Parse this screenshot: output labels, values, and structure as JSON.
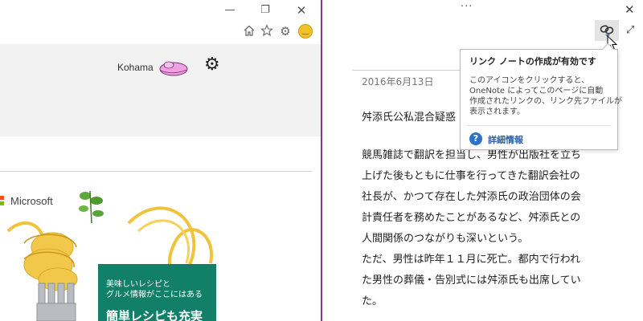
{
  "browser": {
    "window_buttons": {
      "minimize": "—",
      "restore": "❐",
      "close": "✕"
    },
    "toolbar_icons": [
      "home-icon",
      "star-icon",
      "gear-icon",
      "smiley-icon"
    ],
    "header": {
      "username": "Kohama"
    },
    "ad": {
      "brand": "Microsoft",
      "line1": "美味しいレシピと",
      "line2": "グルメ情報がここにはある",
      "line3": "簡単レシピも充実",
      "card_color": "#128068"
    }
  },
  "onenote": {
    "accent_color": "#7a3b8f",
    "menu_dots": "···",
    "close": "✕",
    "expand": "⤢",
    "note": {
      "date": "2016年6月13日",
      "title": "舛添氏公私混合疑惑",
      "body_lines": [
        "競馬雑誌で翻訳を担当し、男性が出版社を立ち",
        "上げた後もともに仕事を行ってきた翻訳会社の",
        "社長が、かつて存在した舛添氏の政治団体の会",
        "計責任者を務めたことがあるなど、舛添氏との",
        "人間関係のつながりも深いという。",
        "ただ、男性は昨年１１月に死亡。都内で行われ",
        "た男性の葬儀・告別式には舛添氏も出席してい",
        "た。"
      ]
    },
    "tooltip": {
      "title": "リンク ノートの作成が有効です",
      "desc_lines": [
        "このアイコンをクリックすると、",
        "OneNote によってこのページに自動",
        "作成されたリンクの、リンク先ファイルが",
        "表示されます。"
      ],
      "help_label": "詳細情報"
    }
  }
}
